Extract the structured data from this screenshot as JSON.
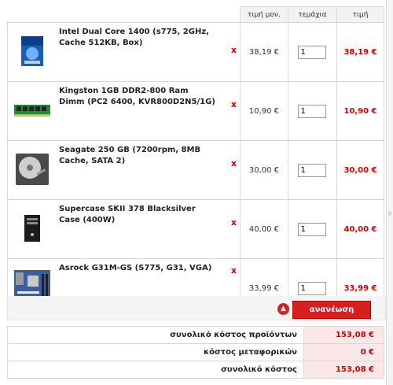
{
  "header": {
    "unit_price": "τιμή μον.",
    "quantity": "τεμάχια",
    "price": "τιμή"
  },
  "items": [
    {
      "name": "Intel Dual Core 1400 (s775, 2GHz, Cache 512KB, Box)",
      "icon": "cpu-box-image",
      "unit_price": "38,19 €",
      "quantity": "1",
      "total": "38,19 €",
      "remove": "x"
    },
    {
      "name": "Kingston 1GB DDR2-800 Ram Dimm (PC2 6400, KVR800D2N5/1G)",
      "icon": "ram-module-image",
      "unit_price": "10,90 €",
      "quantity": "1",
      "total": "10,90 €",
      "remove": "x"
    },
    {
      "name": "Seagate 250 GB (7200rpm, 8MB Cache, SATA 2)",
      "icon": "hard-drive-image",
      "unit_price": "30,00 €",
      "quantity": "1",
      "total": "30,00 €",
      "remove": "x"
    },
    {
      "name": "Supercase SKII 378 Blacksilver Case (400W)",
      "icon": "pc-case-image",
      "unit_price": "40,00 €",
      "quantity": "1",
      "total": "40,00 €",
      "remove": "x"
    },
    {
      "name": "Asrock G31M-GS (S775, G31, VGA)",
      "icon": "motherboard-image",
      "unit_price": "33,99 €",
      "quantity": "1",
      "total": "33,99 €",
      "remove": "x"
    }
  ],
  "update": {
    "label": "ανανέωση",
    "icon": "arrow-up-icon"
  },
  "summary": {
    "products_label": "συνολικό κόστος προϊόντων",
    "products_value": "153,08 €",
    "shipping_label": "κόστος μεταφορικών",
    "shipping_value": "0 €",
    "total_label": "συνολικό κόστος",
    "total_value": "153,08 €"
  },
  "colors": {
    "accent": "#d71f1f",
    "price": "#d40000",
    "summary_bg": "#fbe7e7"
  }
}
